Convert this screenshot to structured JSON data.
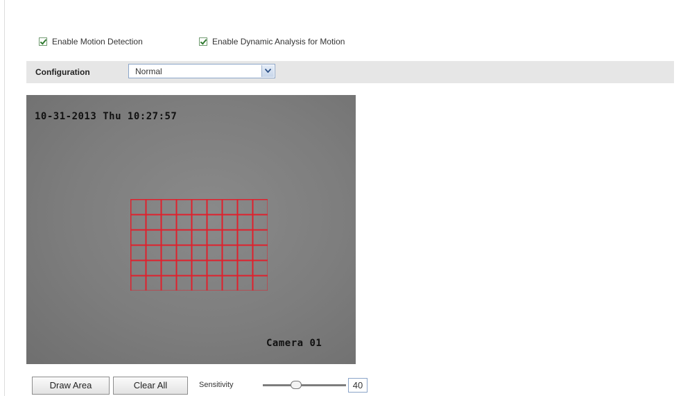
{
  "options": {
    "enable_motion_detection": {
      "label": "Enable Motion Detection",
      "checked": true
    },
    "enable_dynamic_analysis": {
      "label": "Enable Dynamic Analysis for Motion",
      "checked": true
    }
  },
  "configuration": {
    "label": "Configuration",
    "selected": "Normal"
  },
  "video": {
    "timestamp": "10-31-2013 Thu 10:27:57",
    "camera_name": "Camera 01",
    "detection_grid": {
      "columns": 9,
      "rows": 6,
      "color": "#e0202c"
    }
  },
  "controls": {
    "draw_area_label": "Draw Area",
    "clear_all_label": "Clear All",
    "sensitivity_label": "Sensitivity",
    "sensitivity_value": "40",
    "sensitivity_min": 0,
    "sensitivity_max": 100
  }
}
